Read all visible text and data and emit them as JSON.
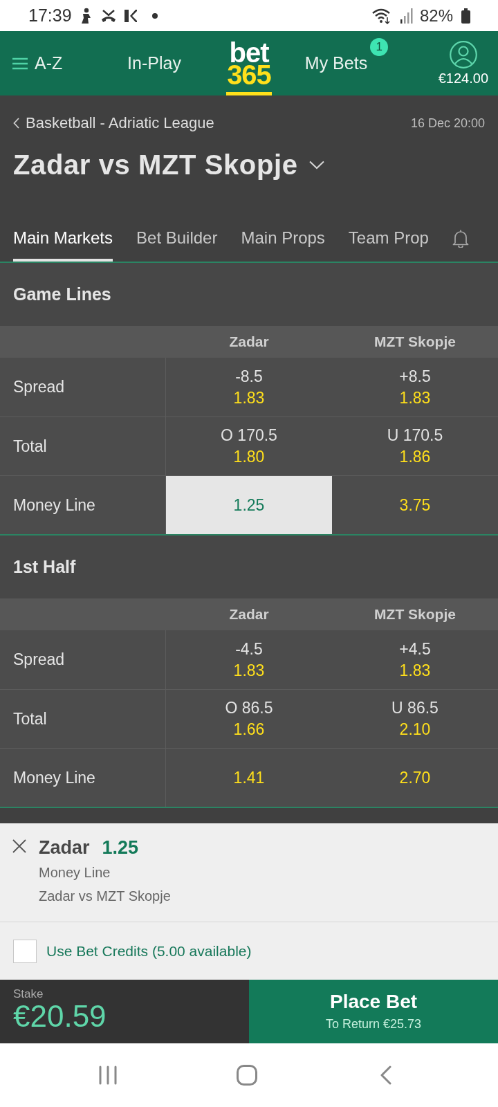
{
  "status_bar": {
    "time": "17:39",
    "battery": "82%"
  },
  "header": {
    "nav": [
      {
        "kind": "menu",
        "label": "A-Z",
        "selected": false
      },
      {
        "kind": "link",
        "label": "In-Play",
        "selected": false
      },
      {
        "kind": "logo",
        "label": "bet",
        "label_2": "365",
        "selected": true
      },
      {
        "kind": "link",
        "label": "My Bets",
        "badge": "1",
        "selected": false
      },
      {
        "kind": "account",
        "label": "€124.00",
        "selected": false
      }
    ]
  },
  "match": {
    "breadcrumb": "Basketball - Adriatic League",
    "datetime": "16 Dec 20:00",
    "title": "Zadar vs MZT Skopje"
  },
  "tabs": [
    {
      "label": "Main Markets",
      "selected": true
    },
    {
      "label": "Bet Builder",
      "selected": false
    },
    {
      "label": "Main Props",
      "selected": false
    },
    {
      "label": "Team Prop",
      "selected": false
    }
  ],
  "sections": [
    {
      "title": "Game Lines",
      "columns": [
        "Zadar",
        "MZT Skopje"
      ],
      "rows": [
        {
          "label": "Spread",
          "cells": [
            {
              "line": "-8.5",
              "odds": "1.83",
              "selected": false
            },
            {
              "line": "+8.5",
              "odds": "1.83",
              "selected": false
            }
          ]
        },
        {
          "label": "Total",
          "cells": [
            {
              "line": "O 170.5",
              "odds": "1.80",
              "selected": false
            },
            {
              "line": "U 170.5",
              "odds": "1.86",
              "selected": false
            }
          ]
        },
        {
          "label": "Money Line",
          "cells": [
            {
              "odds": "1.25",
              "selected": true
            },
            {
              "odds": "3.75",
              "selected": false
            }
          ]
        }
      ]
    },
    {
      "title": "1st Half",
      "columns": [
        "Zadar",
        "MZT Skopje"
      ],
      "rows": [
        {
          "label": "Spread",
          "cells": [
            {
              "line": "-4.5",
              "odds": "1.83",
              "selected": false
            },
            {
              "line": "+4.5",
              "odds": "1.83",
              "selected": false
            }
          ]
        },
        {
          "label": "Total",
          "cells": [
            {
              "line": "O 86.5",
              "odds": "1.66",
              "selected": false
            },
            {
              "line": "U 86.5",
              "odds": "2.10",
              "selected": false
            }
          ]
        },
        {
          "label": "Money Line",
          "cells": [
            {
              "odds": "1.41",
              "selected": false
            },
            {
              "odds": "2.70",
              "selected": false
            }
          ]
        }
      ]
    }
  ],
  "bet_slip": {
    "selection": "Zadar",
    "odds": "1.25",
    "market": "Money Line",
    "event": "Zadar vs MZT Skopje",
    "credits": {
      "label": "Use Bet Credits (5.00 available)",
      "checked": false
    },
    "stake_label": "Stake",
    "stake": "€20.59",
    "place_label": "Place Bet",
    "return_label": "To Return €25.73"
  }
}
